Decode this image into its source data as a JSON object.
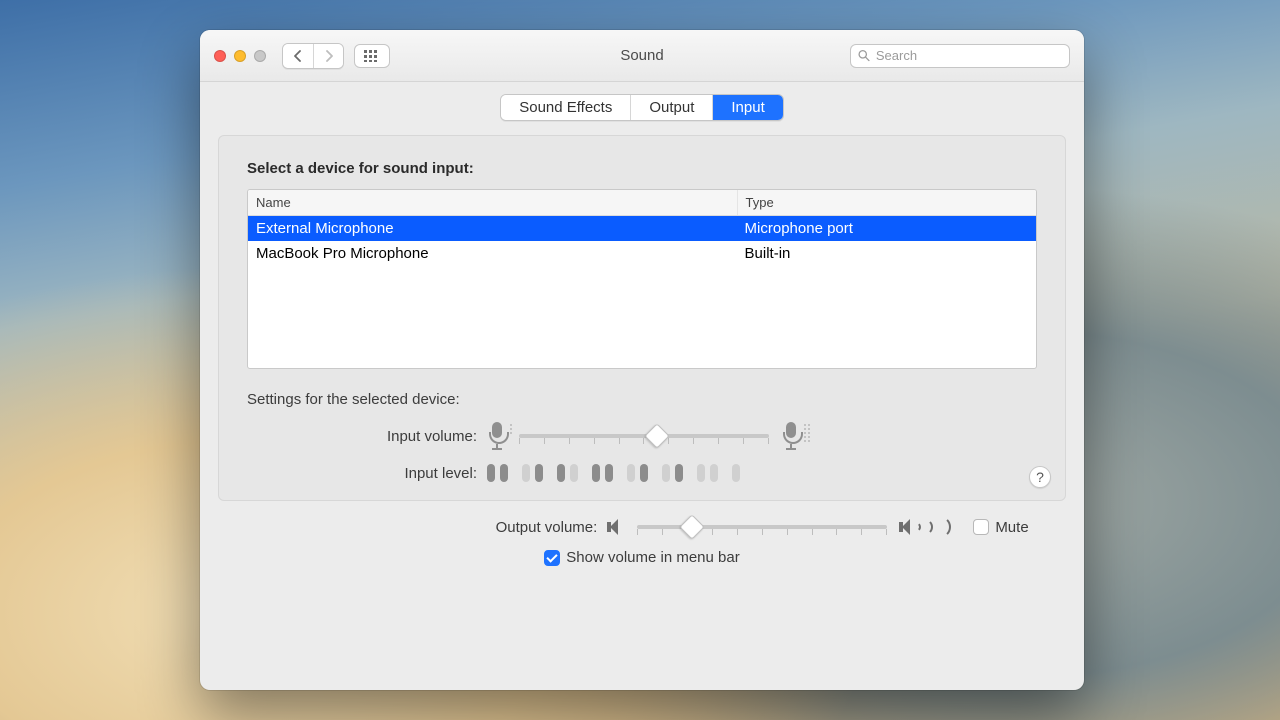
{
  "window": {
    "title": "Sound"
  },
  "search": {
    "placeholder": "Search",
    "value": ""
  },
  "tabs": [
    {
      "label": "Sound Effects",
      "active": false
    },
    {
      "label": "Output",
      "active": false
    },
    {
      "label": "Input",
      "active": true
    }
  ],
  "panel": {
    "heading": "Select a device for sound input:",
    "columns": {
      "name": "Name",
      "type": "Type"
    },
    "devices": [
      {
        "name": "External Microphone",
        "type": "Microphone port",
        "selected": true
      },
      {
        "name": "MacBook Pro Microphone",
        "type": "Built-in",
        "selected": false
      }
    ],
    "settings_heading": "Settings for the selected device:",
    "input_volume_label": "Input volume:",
    "input_volume_percent": 55,
    "input_level_label": "Input level:",
    "input_level_bars": 15,
    "input_level_active_pattern": [
      1,
      1,
      0,
      1,
      1,
      0,
      1,
      1,
      0,
      1,
      0,
      1,
      0,
      0,
      0
    ],
    "help_label": "?"
  },
  "footer": {
    "output_volume_label": "Output volume:",
    "output_volume_percent": 22,
    "mute_label": "Mute",
    "mute_checked": false,
    "show_menu_bar_label": "Show volume in menu bar",
    "show_menu_bar_checked": true
  }
}
